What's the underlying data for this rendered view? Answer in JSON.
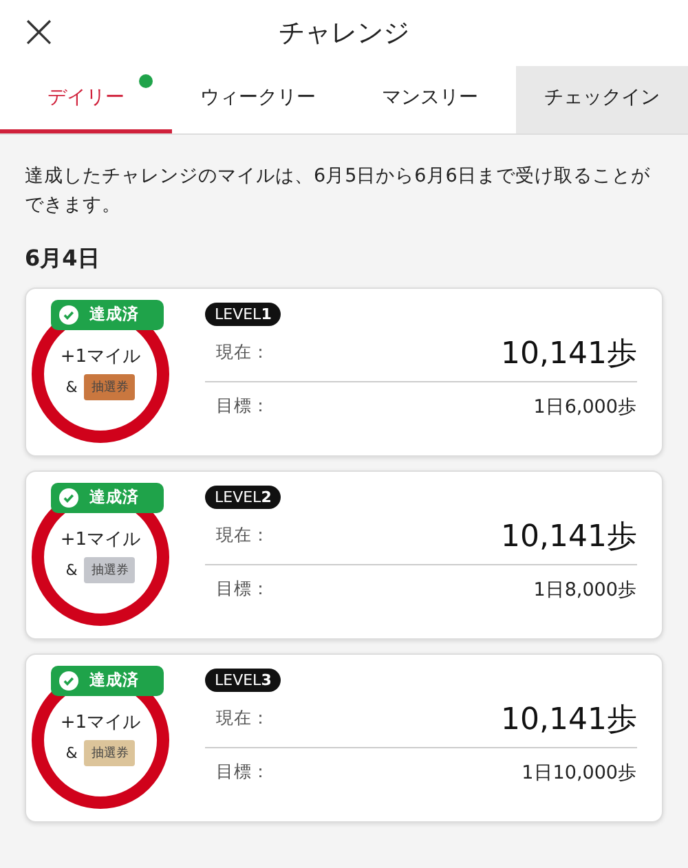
{
  "header": {
    "close": "×",
    "title": "チャレンジ"
  },
  "tabs": [
    {
      "label": "デイリー",
      "selected": true,
      "dot": true,
      "shaded": false
    },
    {
      "label": "ウィークリー",
      "selected": false,
      "dot": false,
      "shaded": false
    },
    {
      "label": "マンスリー",
      "selected": false,
      "dot": false,
      "shaded": false
    },
    {
      "label": "チェックイン",
      "selected": false,
      "dot": false,
      "shaded": true
    }
  ],
  "notice": "達成したチャレンジのマイルは、6月5日から6月6日まで受け取ることができます。",
  "date": "6月4日",
  "cards": [
    {
      "status": "達成済",
      "reward": "+1マイル",
      "and": "&",
      "ticket": "抽選券",
      "color": "#c9773f",
      "level": "LEVEL**1**",
      "current_label": "現在：",
      "current": "10,141歩",
      "goal_label": "目標：",
      "goal": "1日6,000歩"
    },
    {
      "status": "達成済",
      "reward": "+1マイル",
      "and": "&",
      "ticket": "抽選券",
      "color": "#c4c6cc",
      "level": "LEVEL**2**",
      "current_label": "現在：",
      "current": "10,141歩",
      "goal_label": "目標：",
      "goal": "1日8,000歩"
    },
    {
      "status": "達成済",
      "reward": "+1マイル",
      "and": "&",
      "ticket": "抽選券",
      "color": "#dcc49a",
      "level": "LEVEL**3**",
      "current_label": "現在：",
      "current": "10,141歩",
      "goal_label": "目標：",
      "goal": "1日10,000歩"
    }
  ]
}
